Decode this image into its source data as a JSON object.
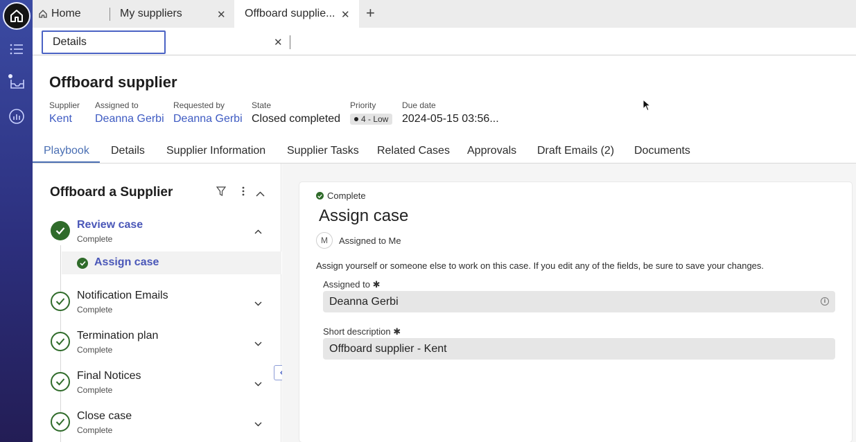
{
  "tabs": [
    {
      "label": "Home"
    },
    {
      "label": "My suppliers"
    },
    {
      "label": "Offboard supplie..."
    }
  ],
  "subtab": {
    "label": "Details"
  },
  "header": {
    "title": "Offboard supplier",
    "fields": [
      {
        "label": "Supplier",
        "value": "Kent"
      },
      {
        "label": "Assigned to",
        "value": "Deanna Gerbi"
      },
      {
        "label": "Requested by",
        "value": "Deanna Gerbi"
      },
      {
        "label": "State",
        "value": "Closed completed"
      },
      {
        "label": "Priority",
        "value": "4 - Low"
      },
      {
        "label": "Due date",
        "value": "2024-05-15 03:56..."
      }
    ]
  },
  "main_tabs": [
    "Playbook",
    "Details",
    "Supplier Information",
    "Supplier Tasks",
    "Related Cases",
    "Approvals",
    "Draft Emails (2)",
    "Documents"
  ],
  "playbook": {
    "title": "Offboard a Supplier",
    "steps": [
      {
        "name": "Review case",
        "status": "Complete"
      },
      {
        "name": "Notification Emails",
        "status": "Complete"
      },
      {
        "name": "Termination plan",
        "status": "Complete"
      },
      {
        "name": "Final Notices",
        "status": "Complete"
      },
      {
        "name": "Close case",
        "status": "Complete"
      }
    ],
    "substep": {
      "name": "Assign case"
    }
  },
  "card": {
    "status": "Complete",
    "title": "Assign case",
    "avatar_initial": "M",
    "assigned_label": "Assigned to Me",
    "instruction": "Assign yourself or someone else to work on this case. If you edit any of the fields, be sure to save your changes.",
    "fields": [
      {
        "label": "Assigned to",
        "value": "Deanna Gerbi"
      },
      {
        "label": "Short description",
        "value": "Offboard supplier - Kent"
      }
    ]
  },
  "colors": {
    "accent": "#4a6fb3",
    "rail": "#2c2f7d",
    "success": "#2f6b2a",
    "link": "#3d5ac2"
  }
}
